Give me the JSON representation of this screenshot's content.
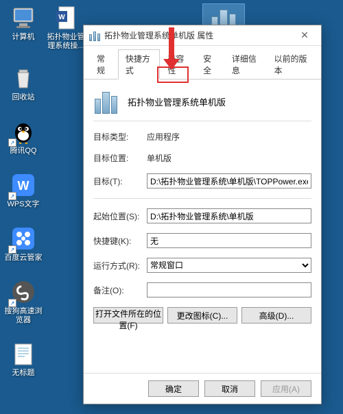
{
  "desktop": {
    "icons": [
      {
        "label": "计算机",
        "kind": "computer"
      },
      {
        "label": "拓扑物业管理系统操...",
        "kind": "word"
      },
      {
        "label": "回收站",
        "kind": "recycle"
      },
      {
        "label": "腾讯QQ",
        "kind": "qq"
      },
      {
        "label": "WPS文字",
        "kind": "wps"
      },
      {
        "label": "百度云管家",
        "kind": "baidu"
      },
      {
        "label": "搜狗高速浏览器",
        "kind": "sogou"
      },
      {
        "label": "无标题",
        "kind": "notepad"
      }
    ],
    "selected_icon": {
      "label": "拓扑物业管理系统操...",
      "kind": "buildings"
    }
  },
  "dialog": {
    "title": "拓扑物业管理系统单机版 属性",
    "tabs": [
      "常规",
      "快捷方式",
      "兼容性",
      "安全",
      "详细信息",
      "以前的版本"
    ],
    "active_tab_index": 1,
    "highlight_tab_index": 2,
    "app_name": "拓扑物业管理系统单机版",
    "fields": {
      "target_type_label": "目标类型:",
      "target_type_value": "应用程序",
      "target_loc_label": "目标位置:",
      "target_loc_value": "单机版",
      "target_label": "目标(T):",
      "target_value": "D:\\拓扑物业管理系统\\单机版\\TOPPower.exe",
      "start_in_label": "起始位置(S):",
      "start_in_value": "D:\\拓扑物业管理系统\\单机版",
      "shortcut_label": "快捷键(K):",
      "shortcut_value": "无",
      "run_label": "运行方式(R):",
      "run_value": "常规窗口",
      "comment_label": "备注(O):",
      "comment_value": ""
    },
    "buttons": {
      "open_location": "打开文件所在的位置(F)",
      "change_icon": "更改图标(C)...",
      "advanced": "高级(D)..."
    },
    "footer": {
      "ok": "确定",
      "cancel": "取消",
      "apply": "应用(A)"
    }
  }
}
